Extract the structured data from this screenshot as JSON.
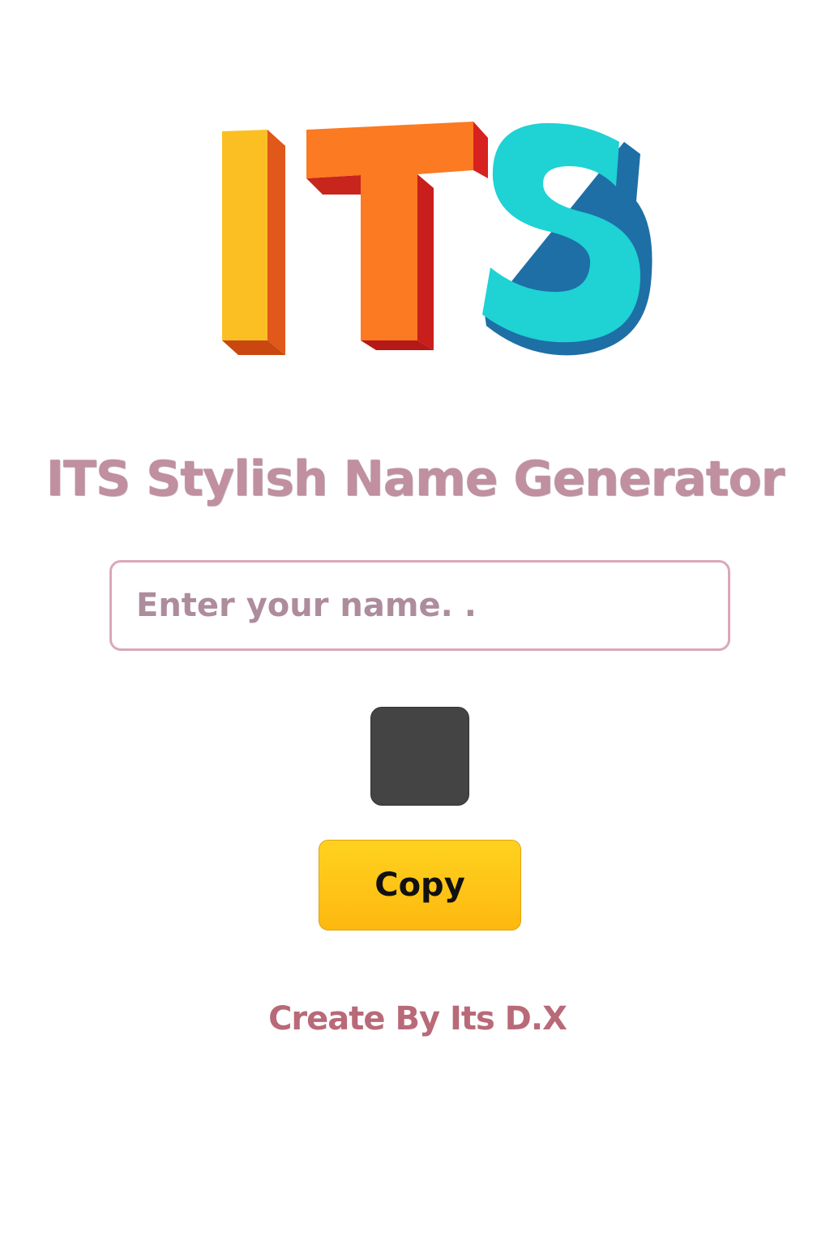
{
  "logo": {
    "text": "ITS",
    "colors": {
      "i_face": "#fbbf24",
      "i_side": "#e0581a",
      "t_face": "#fb7a22",
      "t_side": "#d8221f",
      "s_face": "#1fd2d4",
      "s_side": "#1e6fa5"
    }
  },
  "title": "ITS Stylish Name Generator",
  "name_input": {
    "placeholder": "Enter your name. .",
    "value": ""
  },
  "color_swatch": {
    "color": "#444444"
  },
  "copy_button": {
    "label": "Copy",
    "color": "#fdbf15"
  },
  "credit": "Create By Its D.X"
}
